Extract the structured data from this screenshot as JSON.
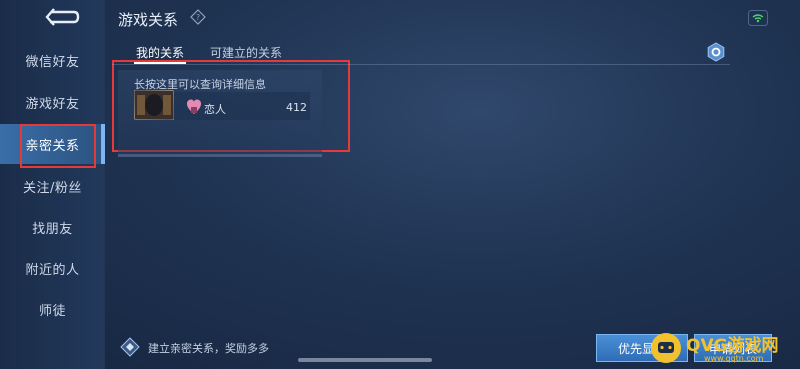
{
  "header": {
    "title": "游戏关系"
  },
  "sidebar": {
    "items": [
      {
        "label": "微信好友"
      },
      {
        "label": "游戏好友"
      },
      {
        "label": "亲密关系"
      },
      {
        "label": "关注/粉丝"
      },
      {
        "label": "找朋友"
      },
      {
        "label": "附近的人"
      },
      {
        "label": "师徒"
      }
    ]
  },
  "tabs": [
    {
      "label": "我的关系"
    },
    {
      "label": "可建立的关系"
    }
  ],
  "card": {
    "hint": "长按这里可以查询详细信息",
    "relation_label": "恋人",
    "intimacy": "412"
  },
  "footer": {
    "hint": "建立亲密关系，奖励多多",
    "priority_button": "优先显示",
    "apply_button": "申请列表"
  },
  "watermark": {
    "text": "QVG游戏网",
    "url": "www.qqtn.com"
  },
  "colors": {
    "accent": "#4a90d8",
    "highlight": "#e63a3a",
    "sidebar_active": "#3a6ea8",
    "relation": "#e38ab5"
  }
}
